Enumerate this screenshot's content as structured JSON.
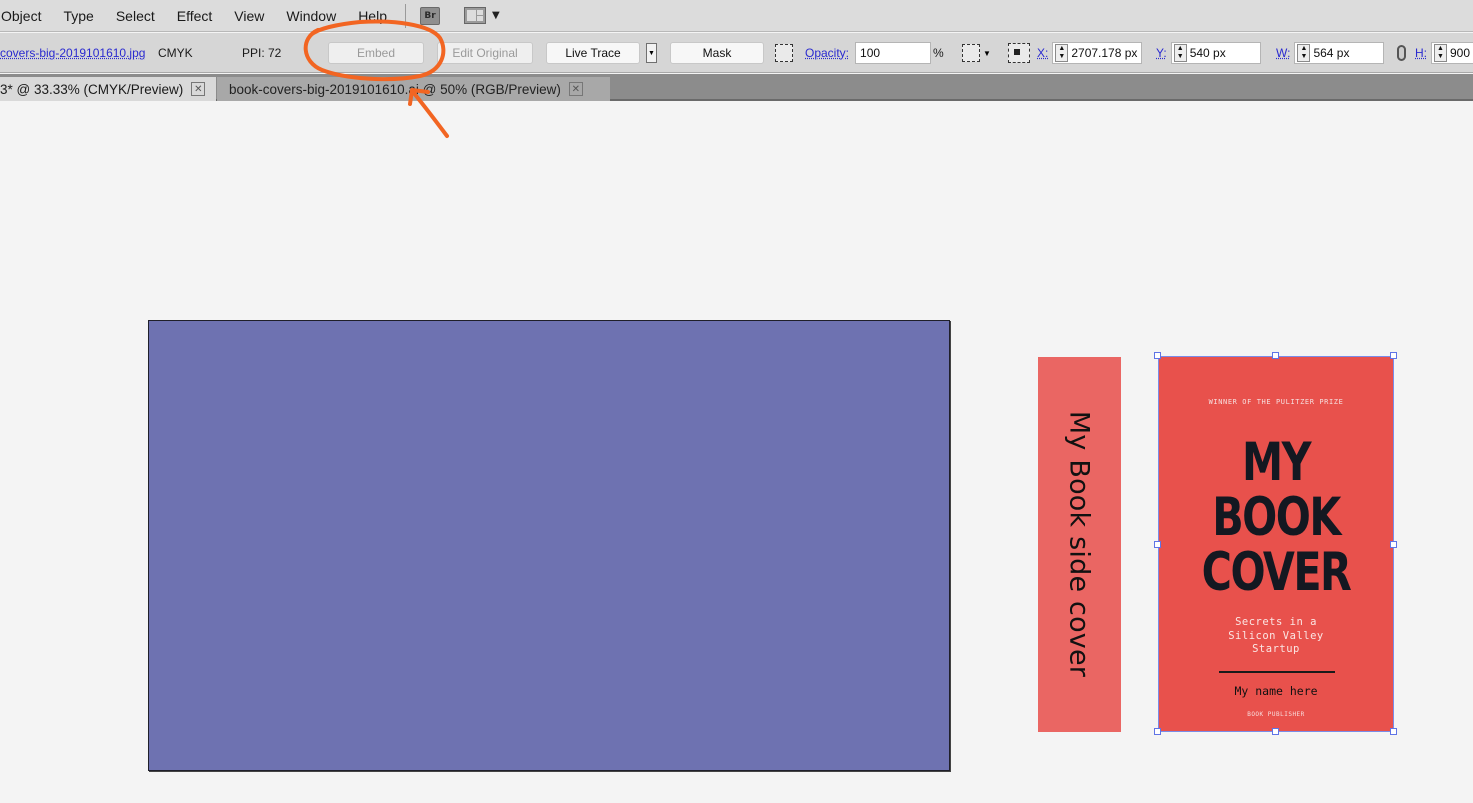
{
  "menubar": {
    "items": [
      "Object",
      "Type",
      "Select",
      "Effect",
      "View",
      "Window",
      "Help"
    ],
    "bridge_label": "Br",
    "workspace_icon": "workspace-layout-icon"
  },
  "controlbar": {
    "filename": "covers-big-2019101610.jpg",
    "color_mode": "CMYK",
    "ppi": "PPI: 72",
    "embed_label": "Embed",
    "edit_original_label": "Edit Original",
    "live_trace_label": "Live Trace",
    "mask_label": "Mask",
    "opacity_label": "Opacity:",
    "opacity_value": "100",
    "opacity_unit": "%",
    "x_label": "X:",
    "x_value": "2707.178 px",
    "y_label": "Y:",
    "y_value": "540 px",
    "w_label": "W:",
    "w_value": "564 px",
    "h_label": "H:",
    "h_value": "900"
  },
  "tabs": [
    {
      "label": "3* @ 33.33% (CMYK/Preview)",
      "active": true
    },
    {
      "label": "book-covers-big-2019101610.ai @ 50% (RGB/Preview)",
      "active": false
    }
  ],
  "canvas": {
    "artboard_color": "#6e72b1",
    "spine_text": "My Book side cover",
    "spine_color": "#ea6663",
    "cover": {
      "color": "#e8514c",
      "award": "WINNER OF THE PULITZER PRIZE",
      "title_lines": [
        "MY",
        "BOOK",
        "COVER"
      ],
      "subtitle": "Secrets in a\nSilicon Valley\nStartup",
      "author": "My name here",
      "publisher": "BOOK PUBLISHER"
    }
  },
  "annotation": {
    "color": "#f26522",
    "target": "embed-button"
  }
}
